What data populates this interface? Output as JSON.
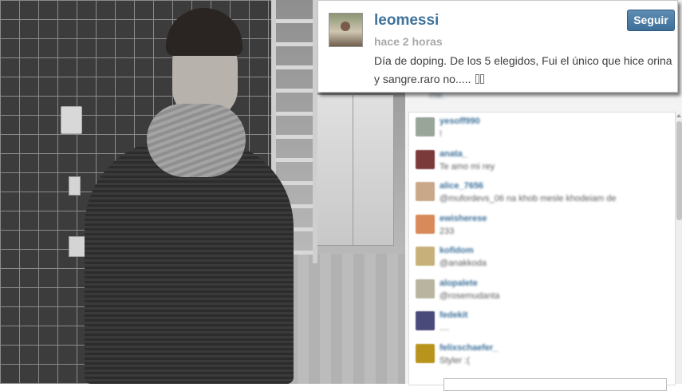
{
  "post": {
    "username": "leomessi",
    "time_ago": "hace 2 horas",
    "caption": "Día de doping. De los 5 elegidos, Fui el único que hice orina y sangre.raro no.....",
    "follow_label": "Seguir"
  },
  "feed": {
    "likes_text": "me.",
    "comments": [
      {
        "user": "yesoff990",
        "text": "!",
        "avatar_color": "#9aa59a"
      },
      {
        "user": "anata_",
        "text": "Te amo mi rey",
        "avatar_color": "#7a3a3a"
      },
      {
        "user": "alice_7656",
        "text": "@mufordevs_06 na khob mesle khodeiam de",
        "avatar_color": "#c9a88a"
      },
      {
        "user": "ewisherese",
        "text": "233",
        "avatar_color": "#d98a5a"
      },
      {
        "user": "kofidom",
        "text": "@anakkoda",
        "avatar_color": "#c8b07a"
      },
      {
        "user": "alopalete",
        "text": "@rosemudanta",
        "avatar_color": "#b9b4a0"
      },
      {
        "user": "fedekit",
        "text": "....",
        "avatar_color": "#4a4a7a"
      },
      {
        "user": "felixschaefer_",
        "text": "Styler :(",
        "avatar_color": "#b8941c"
      }
    ]
  },
  "colors": {
    "link_blue": "#3f729b",
    "button_blue": "#3e6f99",
    "muted_text": "#a9a9a9"
  }
}
